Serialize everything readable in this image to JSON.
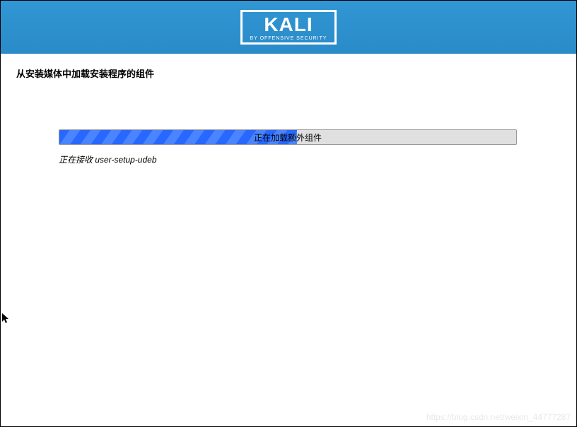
{
  "header": {
    "logo_main": "KALI",
    "logo_sub": "BY OFFENSIVE SECURITY"
  },
  "page": {
    "title": "从安装媒体中加载安装程序的组件"
  },
  "progress": {
    "label": "正在加载额外组件",
    "percent": 52,
    "status": "正在接收 user-setup-udeb"
  },
  "watermark": "https://blog.csdn.net/weixin_44777287"
}
